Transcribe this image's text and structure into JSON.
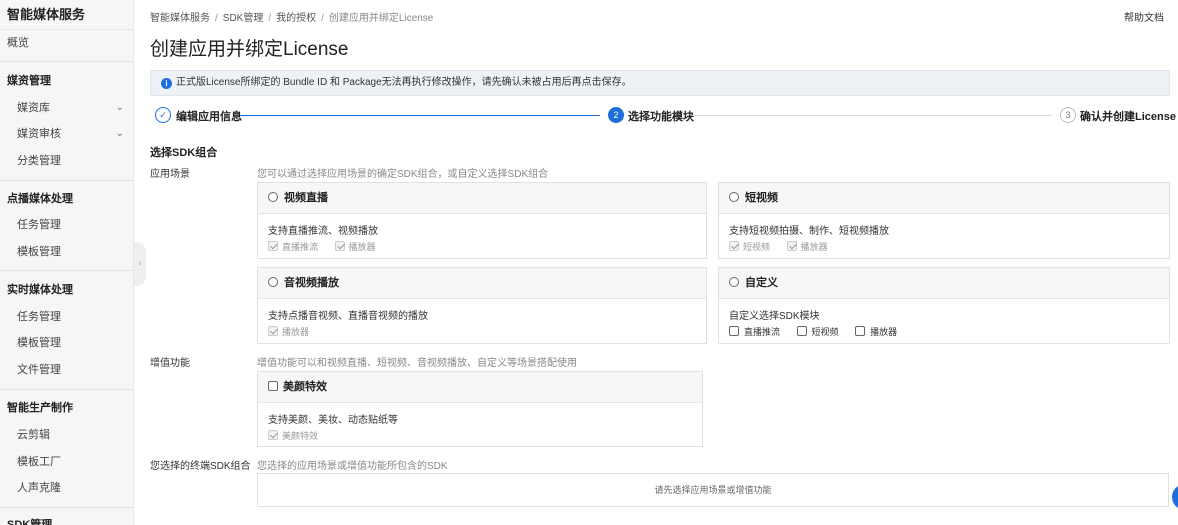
{
  "sidebar": {
    "title": "智能媒体服务",
    "overview": "概览",
    "groups": [
      {
        "label": "媒资管理",
        "items": [
          {
            "label": "媒资库",
            "chevron": true
          },
          {
            "label": "媒资审核",
            "chevron": true
          },
          {
            "label": "分类管理"
          }
        ]
      },
      {
        "label": "点播媒体处理",
        "items": [
          {
            "label": "任务管理"
          },
          {
            "label": "模板管理"
          }
        ]
      },
      {
        "label": "实时媒体处理",
        "items": [
          {
            "label": "任务管理"
          },
          {
            "label": "模板管理"
          },
          {
            "label": "文件管理"
          }
        ]
      },
      {
        "label": "智能生产制作",
        "items": [
          {
            "label": "云剪辑"
          },
          {
            "label": "模板工厂"
          },
          {
            "label": "人声克隆"
          }
        ]
      },
      {
        "label": "SDK管理",
        "items": []
      }
    ],
    "chevron_glyph": "⌄",
    "collapse_glyph": "‹"
  },
  "breadcrumb": {
    "items": [
      "智能媒体服务",
      "SDK管理",
      "我的授权"
    ],
    "current": "创建应用并绑定License",
    "separator": "/"
  },
  "help_link": "帮助文档",
  "page_title": "创建应用并绑定License",
  "notice": {
    "icon_glyph": "i",
    "text": "正式版License所绑定的 Bundle ID 和 Package无法再执行修改操作，请先确认未被占用后再点击保存。"
  },
  "steps": [
    {
      "index": "✓",
      "label": "编辑应用信息",
      "status": "done"
    },
    {
      "index": "2",
      "label": "选择功能模块",
      "status": "active"
    },
    {
      "index": "3",
      "label": "确认并创建License",
      "status": "pending"
    }
  ],
  "colors": {
    "primary": "#1d6fdc",
    "pending_line": "#d9d9d9"
  },
  "section_title": "选择SDK组合",
  "scenario": {
    "label": "应用场景",
    "hint": "您可以通过选择应用场景的确定SDK组合，或自定义选择SDK组合",
    "cards": [
      {
        "title": "视频直播",
        "desc": "支持直播推流、视频播放",
        "options": [
          "直播推流",
          "播放器"
        ]
      },
      {
        "title": "短视频",
        "desc": "支持短视频拍摄、制作、短视频播放",
        "options": [
          "短视频",
          "播放器"
        ]
      },
      {
        "title": "音视频播放",
        "desc": "支持点播音视频、直播音视频的播放",
        "options": [
          "播放器"
        ]
      },
      {
        "title": "自定义",
        "desc": "自定义选择SDK模块",
        "options": [
          "直播推流",
          "短视频",
          "播放器"
        ]
      }
    ]
  },
  "addon": {
    "label": "增值功能",
    "hint": "增值功能可以和视频直播、短视频、音视频播放、自定义等场景搭配使用",
    "card": {
      "title": "美颜特效",
      "desc": "支持美颜、美妆、动态贴纸等",
      "options": [
        "美颜特效"
      ]
    }
  },
  "final": {
    "label": "您选择的终端SDK组合",
    "hint": "您选择的应用场景或增值功能所包含的SDK",
    "empty_text": "请先选择应用场景或增值功能"
  }
}
